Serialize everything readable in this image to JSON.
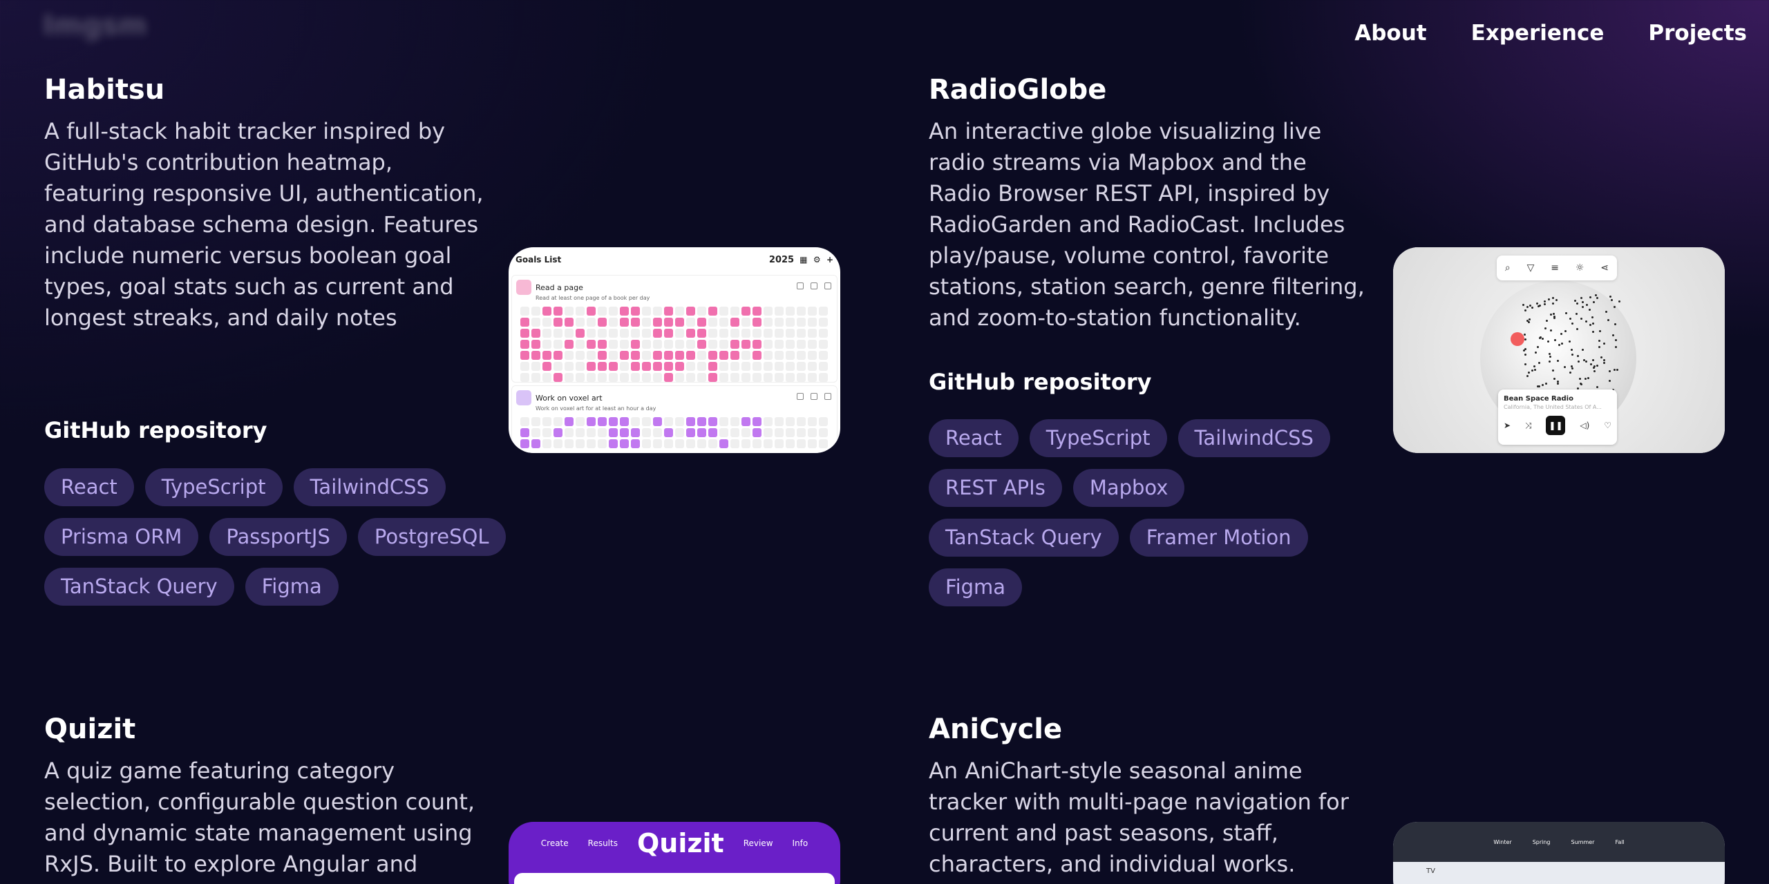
{
  "logo": "Imgsm",
  "nav": {
    "about": "About",
    "experience": "Experience",
    "projects": "Projects"
  },
  "projects": [
    {
      "title": "Habitsu",
      "description": "A full-stack habit tracker inspired by GitHub's contribution heatmap, featuring responsive UI, authentication, and database schema design. Features include numeric versus boolean goal types, goal stats such as current and longest streaks, and daily notes",
      "repo": "GitHub repository",
      "tags": [
        "React",
        "TypeScript",
        "TailwindCSS",
        "Prisma ORM",
        "PassportJS",
        "PostgreSQL",
        "TanStack Query",
        "Figma"
      ],
      "preview": {
        "header": "Goals List",
        "year": "2025",
        "goals": [
          {
            "name": "Read a page",
            "subtitle": "Read at least one page of a book per day"
          },
          {
            "name": "Work on voxel art",
            "subtitle": "Work on voxel art for at least an hour a day"
          }
        ]
      }
    },
    {
      "title": "RadioGlobe",
      "description": "An interactive globe visualizing live radio streams via Mapbox and the Radio Browser REST API, inspired by RadioGarden and RadioCast. Includes play/pause, volume control, favorite stations, station search, genre filtering, and zoom-to-station functionality.",
      "repo": "GitHub repository",
      "tags": [
        "React",
        "TypeScript",
        "TailwindCSS",
        "REST APIs",
        "Mapbox",
        "TanStack Query",
        "Framer Motion",
        "Figma"
      ],
      "preview": {
        "station": "Bean Space Radio",
        "location": "California, The United States Of A..."
      }
    },
    {
      "title": "Quizit",
      "description": "A quiz game featuring category selection, configurable question count, and dynamic state management using RxJS. Built to explore Angular and reactive",
      "preview": {
        "brand": "Quizit",
        "links": [
          "Create",
          "Results",
          "Review",
          "Info"
        ]
      }
    },
    {
      "title": "AniCycle",
      "description": "An AniChart-style seasonal anime tracker with multi-page navigation for current and past seasons, staff, characters, and individual works. Features responsive",
      "preview": {
        "seasons": [
          "Winter",
          "Spring",
          "Summer",
          "Fall"
        ],
        "section": "TV"
      }
    }
  ]
}
